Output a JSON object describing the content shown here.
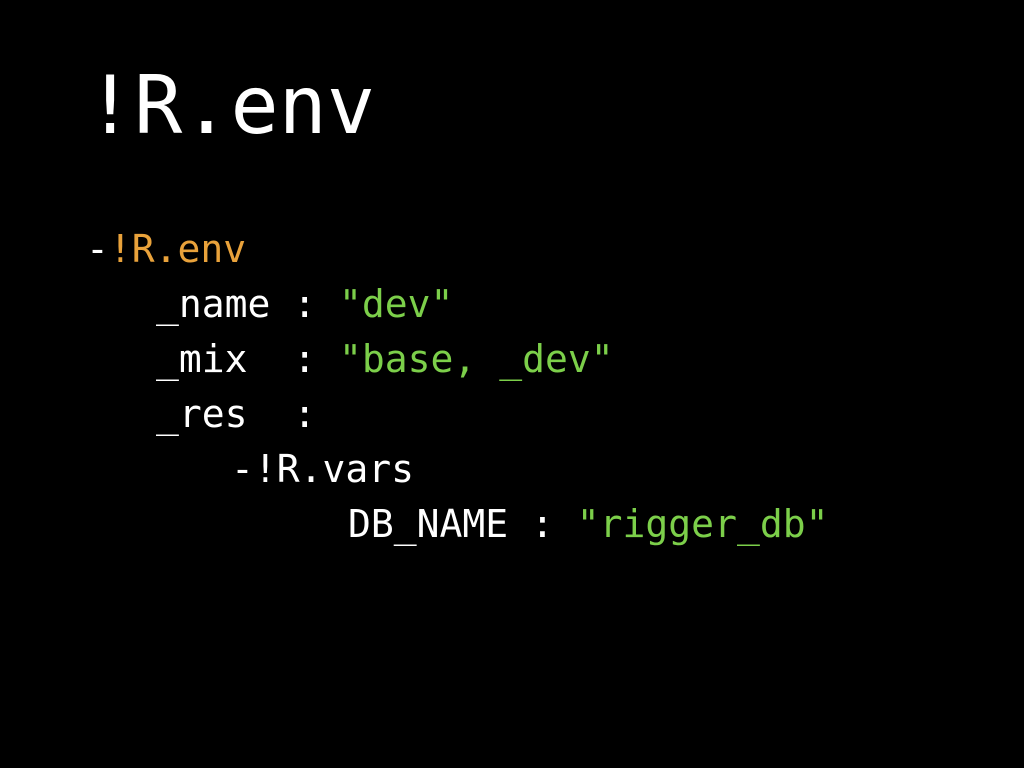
{
  "title": "!R.env",
  "colors": {
    "background": "#000000",
    "text": "#ffffff",
    "tag": "#e9a23b",
    "string": "#7ccf4a"
  },
  "code": {
    "line1": {
      "dash": "-",
      "tag": "!R.env"
    },
    "line2": {
      "key": "_name :",
      "value": "\"dev\""
    },
    "line3": {
      "key": "_mix  :",
      "value": "\"base, _dev\""
    },
    "line4": {
      "key": "_res  :"
    },
    "line5": {
      "text": "-!R.vars"
    },
    "line6": {
      "key": "DB_NAME :",
      "value": "\"rigger_db\""
    }
  }
}
